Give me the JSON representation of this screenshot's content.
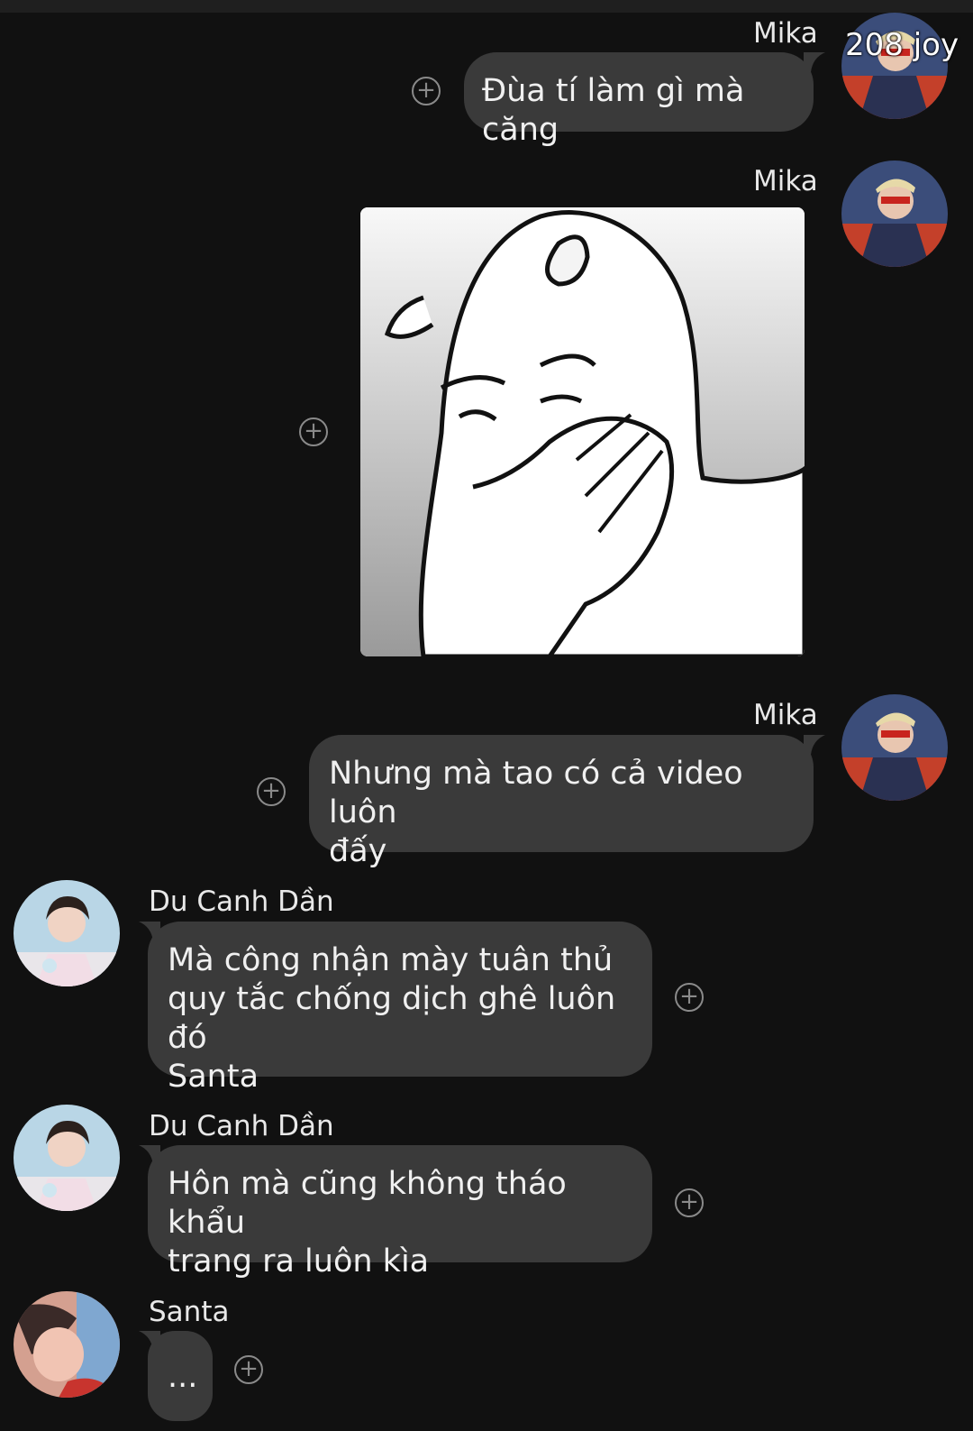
{
  "messages": [
    {
      "sender": "Mika",
      "text": "Đùa tí làm gì mà căng",
      "side": "right"
    },
    {
      "sender": "Mika",
      "type": "sticker",
      "sticker": "face-palm-meme-sticker",
      "side": "right"
    },
    {
      "sender": "Mika",
      "text_line1": "Nhưng mà tao có cả video luôn",
      "text_line2": "đấy",
      "side": "right"
    },
    {
      "sender": "Du Canh Dần",
      "text_line1": "Mà công nhận mày tuân thủ",
      "text_line2": "quy tắc chống dịch ghê luôn đó",
      "text_line3": "Santa",
      "side": "left"
    },
    {
      "sender": "Du Canh Dần",
      "text_line1": "Hôn mà cũng không tháo khẩu",
      "text_line2": "trang ra luôn kìa",
      "side": "left"
    },
    {
      "sender": "Santa",
      "text": "...",
      "side": "left"
    }
  ],
  "overlay_label": "208 joy",
  "icons": {
    "react": "plus-circle-icon",
    "avatar": "user-avatar"
  },
  "colors": {
    "background": "#111111",
    "bubble": "#3a3a3a",
    "text": "#f0f0f0",
    "icon": "#8a8a8a"
  }
}
